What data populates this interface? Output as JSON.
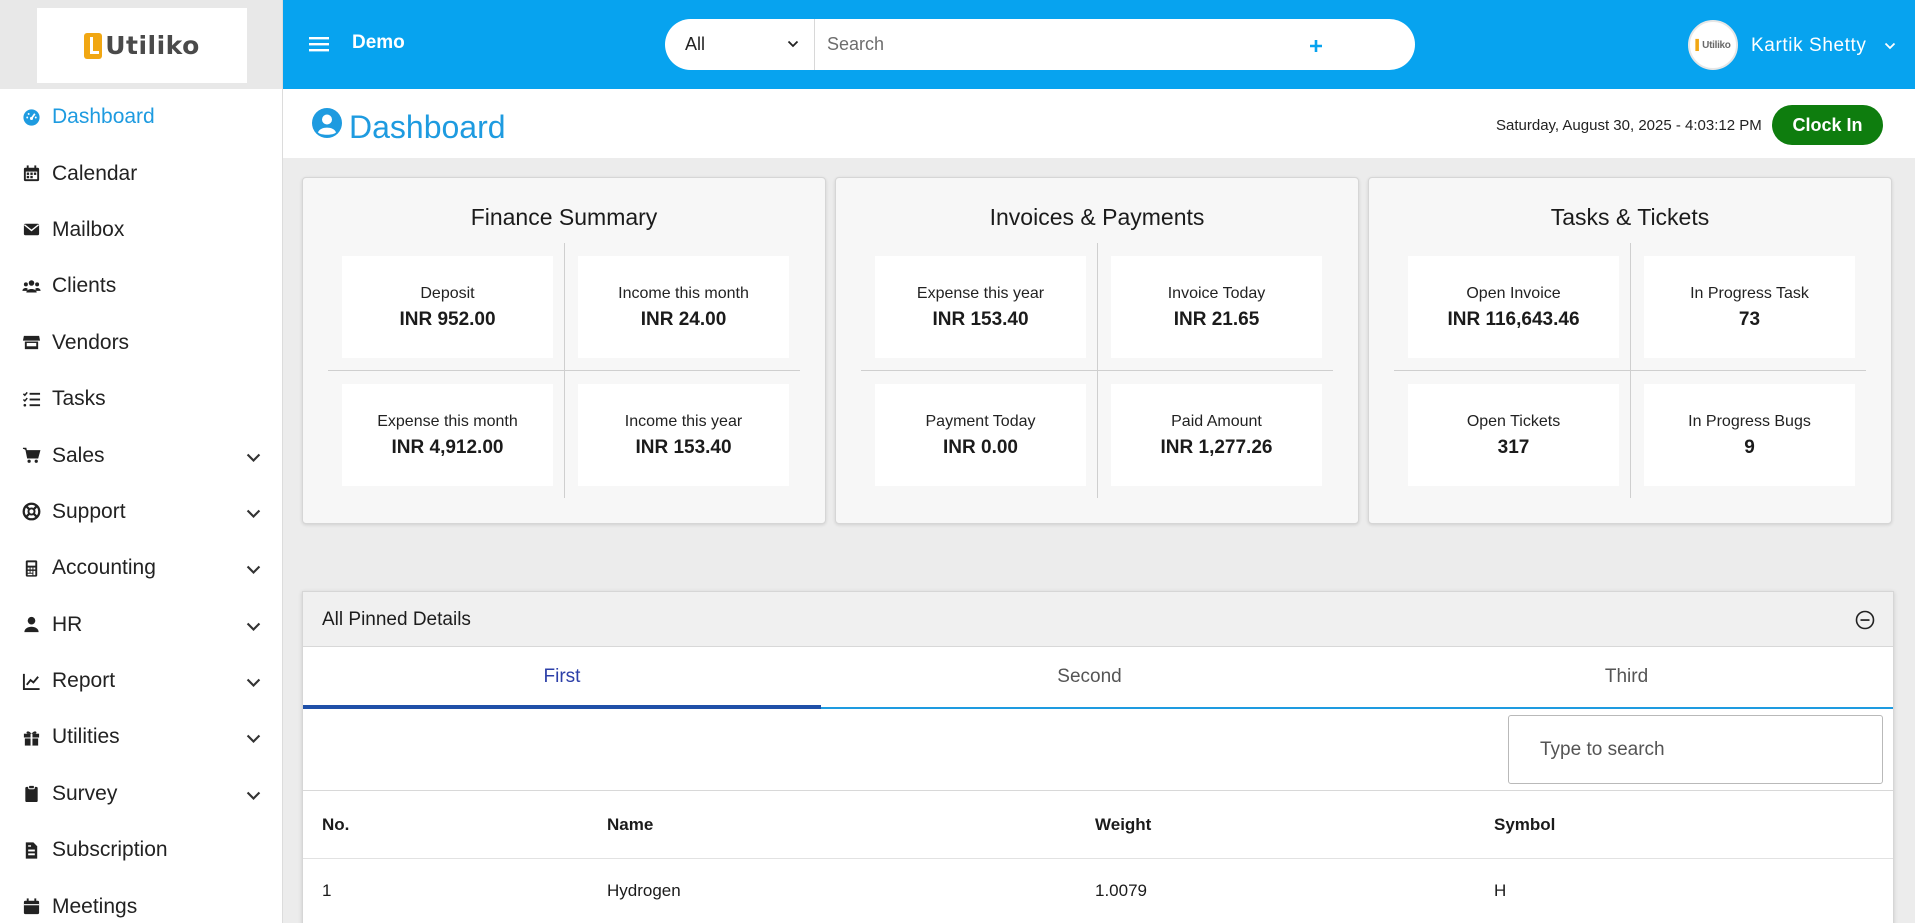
{
  "brand": {
    "logo_text": "Utiliko",
    "brand_color": "#f1a713"
  },
  "sidebar": {
    "items": [
      {
        "label": "Dashboard",
        "icon": "dashboard-icon",
        "active": true,
        "has_submenu": false
      },
      {
        "label": "Calendar",
        "icon": "calendar-icon",
        "active": false,
        "has_submenu": false
      },
      {
        "label": "Mailbox",
        "icon": "envelope-icon",
        "active": false,
        "has_submenu": false
      },
      {
        "label": "Clients",
        "icon": "users-icon",
        "active": false,
        "has_submenu": false
      },
      {
        "label": "Vendors",
        "icon": "store-icon",
        "active": false,
        "has_submenu": false
      },
      {
        "label": "Tasks",
        "icon": "tasks-icon",
        "active": false,
        "has_submenu": false
      },
      {
        "label": "Sales",
        "icon": "cart-icon",
        "active": false,
        "has_submenu": true
      },
      {
        "label": "Support",
        "icon": "lifebuoy-icon",
        "active": false,
        "has_submenu": true
      },
      {
        "label": "Accounting",
        "icon": "calculator-icon",
        "active": false,
        "has_submenu": true
      },
      {
        "label": "HR",
        "icon": "user-icon",
        "active": false,
        "has_submenu": true
      },
      {
        "label": "Report",
        "icon": "line-chart-icon",
        "active": false,
        "has_submenu": true
      },
      {
        "label": "Utilities",
        "icon": "gift-icon",
        "active": false,
        "has_submenu": true
      },
      {
        "label": "Survey",
        "icon": "clipboard-icon",
        "active": false,
        "has_submenu": true
      },
      {
        "label": "Subscription",
        "icon": "file-invoice-icon",
        "active": false,
        "has_submenu": false
      },
      {
        "label": "Meetings",
        "icon": "calendar-icon",
        "active": false,
        "has_submenu": false
      }
    ]
  },
  "header": {
    "workspace": "Demo",
    "search": {
      "scope": "All",
      "placeholder": "Search",
      "value": ""
    },
    "icons": [
      "help-icon",
      "add-icon",
      "bell-icon"
    ],
    "user": {
      "name": "Kartik Shetty",
      "avatar_text": "Utiliko"
    },
    "color": "#07a3ef"
  },
  "page": {
    "title": "Dashboard",
    "datetime": "Saturday, August 30, 2025 -  4:03:12 PM",
    "clock_in_label": "Clock In",
    "clock_in_color": "#0e7d0e"
  },
  "cards": [
    {
      "title": "Finance Summary",
      "stats": [
        {
          "label": "Deposit",
          "value": "INR 952.00"
        },
        {
          "label": "Income this month",
          "value": "INR 24.00"
        },
        {
          "label": "Expense this month",
          "value": "INR 4,912.00"
        },
        {
          "label": "Income this year",
          "value": "INR 153.40"
        }
      ]
    },
    {
      "title": "Invoices & Payments",
      "stats": [
        {
          "label": "Expense this year",
          "value": "INR 153.40"
        },
        {
          "label": "Invoice Today",
          "value": "INR 21.65"
        },
        {
          "label": "Payment Today",
          "value": "INR 0.00"
        },
        {
          "label": "Paid Amount",
          "value": "INR 1,277.26"
        }
      ]
    },
    {
      "title": "Tasks & Tickets",
      "stats": [
        {
          "label": "Open Invoice",
          "value": "INR 116,643.46"
        },
        {
          "label": "In Progress Task",
          "value": "73"
        },
        {
          "label": "Open Tickets",
          "value": "317"
        },
        {
          "label": "In Progress Bugs",
          "value": "9"
        }
      ]
    }
  ],
  "pinned": {
    "title": "All Pinned Details",
    "tabs": [
      {
        "label": "First",
        "active": true
      },
      {
        "label": "Second",
        "active": false
      },
      {
        "label": "Third",
        "active": false
      }
    ],
    "search_placeholder": "Type to search",
    "columns": [
      "No.",
      "Name",
      "Weight",
      "Symbol"
    ],
    "rows": [
      [
        "1",
        "Hydrogen",
        "1.0079",
        "H"
      ]
    ]
  }
}
